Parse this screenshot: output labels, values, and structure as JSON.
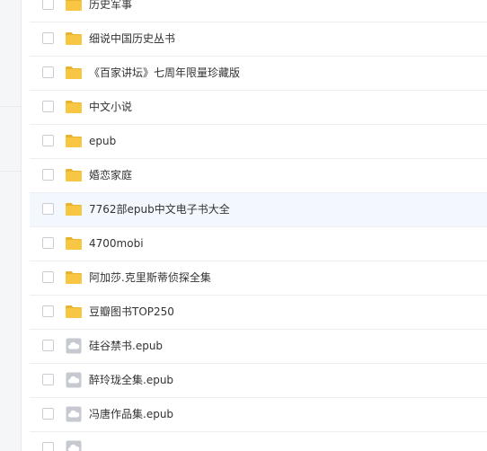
{
  "file_list": {
    "items": [
      {
        "name": "历史军事",
        "icon": "folder-icon"
      },
      {
        "name": "细说中国历史丛书",
        "icon": "folder-icon"
      },
      {
        "name": "《百家讲坛》七周年限量珍藏版",
        "icon": "folder-icon"
      },
      {
        "name": "中文小说",
        "icon": "folder-icon"
      },
      {
        "name": "epub",
        "icon": "folder-icon"
      },
      {
        "name": "婚恋家庭",
        "icon": "folder-icon"
      },
      {
        "name": "7762部epub中文电子书大全",
        "icon": "folder-icon",
        "hovered": true
      },
      {
        "name": "4700mobi",
        "icon": "folder-icon"
      },
      {
        "name": "阿加莎.克里斯蒂侦探全集",
        "icon": "folder-icon"
      },
      {
        "name": "豆瓣图书TOP250",
        "icon": "folder-icon"
      },
      {
        "name": "硅谷禁书.epub",
        "icon": "cloud-file-icon"
      },
      {
        "name": "醉玲珑全集.epub",
        "icon": "cloud-file-icon"
      },
      {
        "name": "冯唐作品集.epub",
        "icon": "cloud-file-icon"
      },
      {
        "name": "",
        "icon": "cloud-file-icon"
      }
    ]
  },
  "colors": {
    "folder": "#f7c744",
    "folder_dark": "#e9b22f",
    "cloud_file": "#c6cad0",
    "hover_row": "#f3f8fe",
    "text": "#333333"
  }
}
